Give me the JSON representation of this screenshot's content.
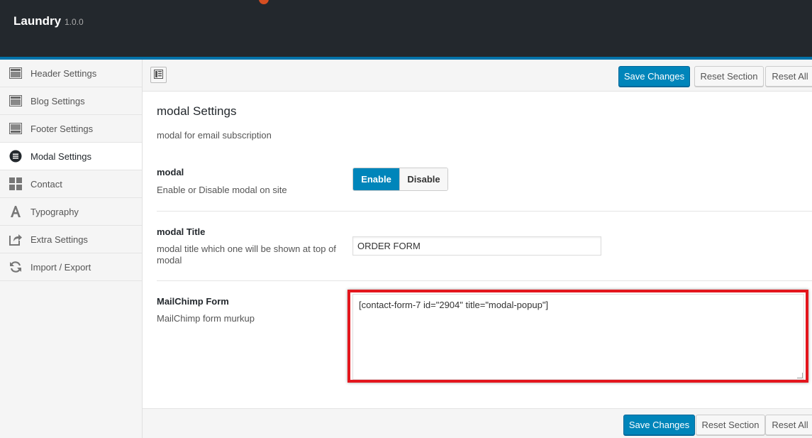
{
  "header": {
    "app_title": "Laundry",
    "app_version": "1.0.0"
  },
  "sidebar": {
    "items": [
      {
        "label": "Header Settings",
        "icon": "layout-icon",
        "active": false
      },
      {
        "label": "Blog Settings",
        "icon": "layout-icon",
        "active": false
      },
      {
        "label": "Footer Settings",
        "icon": "layout-icon",
        "active": false
      },
      {
        "label": "Modal Settings",
        "icon": "list-circle-icon",
        "active": true
      },
      {
        "label": "Contact",
        "icon": "grid-icon",
        "active": false
      },
      {
        "label": "Typography",
        "icon": "typography-icon",
        "active": false
      },
      {
        "label": "Extra Settings",
        "icon": "export-icon",
        "active": false
      },
      {
        "label": "Import / Export",
        "icon": "refresh-icon",
        "active": false
      }
    ]
  },
  "toolbar": {
    "save_label": "Save Changes",
    "reset_section_label": "Reset Section",
    "reset_all_label": "Reset All"
  },
  "section": {
    "title": "modal Settings",
    "description": "modal for email subscription"
  },
  "fields": {
    "modal": {
      "label": "modal",
      "description": "Enable or Disable modal on site",
      "enable_label": "Enable",
      "disable_label": "Disable",
      "selected": "Enable"
    },
    "modal_title": {
      "label": "modal Title",
      "description": "modal title which one will be shown at top of modal",
      "value": "ORDER FORM"
    },
    "mailchimp": {
      "label": "MailChimp Form",
      "description": "MailChimp form murkup",
      "value": "[contact-form-7 id=\"2904\" title=\"modal-popup\"]"
    }
  },
  "footer": {
    "save_label": "Save Changes",
    "reset_section_label": "Reset Section",
    "reset_all_label": "Reset All"
  },
  "colors": {
    "header_bg": "#23282d",
    "accent": "#0085ba",
    "highlight": "#e3161d"
  }
}
